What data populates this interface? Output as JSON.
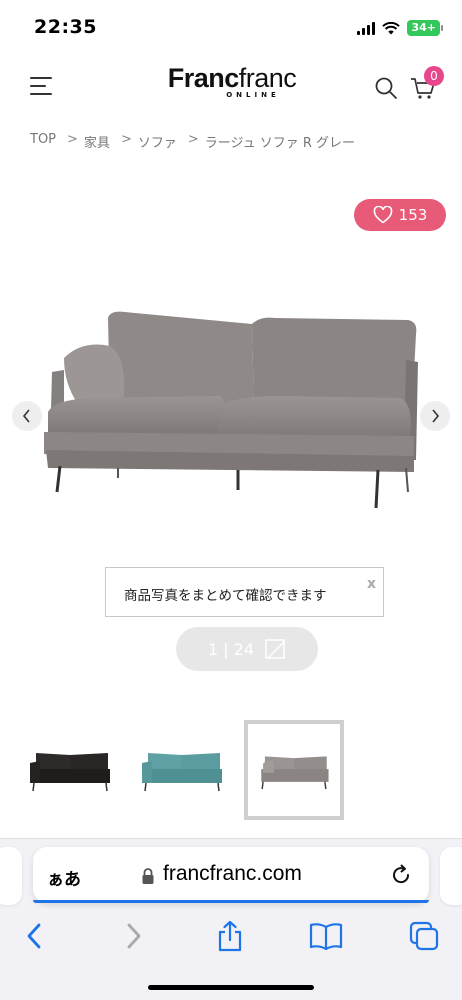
{
  "status_bar": {
    "time": "22:35",
    "battery": "34+"
  },
  "header": {
    "logo_main_bold": "Franc",
    "logo_main_light": "franc",
    "logo_sub": "ONLINE",
    "cart_count": "0"
  },
  "breadcrumb": {
    "items": [
      "TOP",
      "家具",
      "ソファ"
    ],
    "current": "ラージュ ソファ R グレー",
    "separator": ">"
  },
  "favorite": {
    "count": "153"
  },
  "gallery": {
    "tooltip": "商品写真をまとめて確認できます",
    "tooltip_close": "x",
    "counter": "1 | 24",
    "thumbnails": [
      {
        "color": "black"
      },
      {
        "color": "teal"
      },
      {
        "color": "gray",
        "selected": true
      }
    ]
  },
  "browser": {
    "aa_label": "ぁあ",
    "url": "francfranc.com"
  },
  "colors": {
    "favorite_pink": "#e75a78",
    "cart_badge": "#e8468c",
    "safari_blue": "#1f74e8",
    "battery_green": "#34c759"
  }
}
